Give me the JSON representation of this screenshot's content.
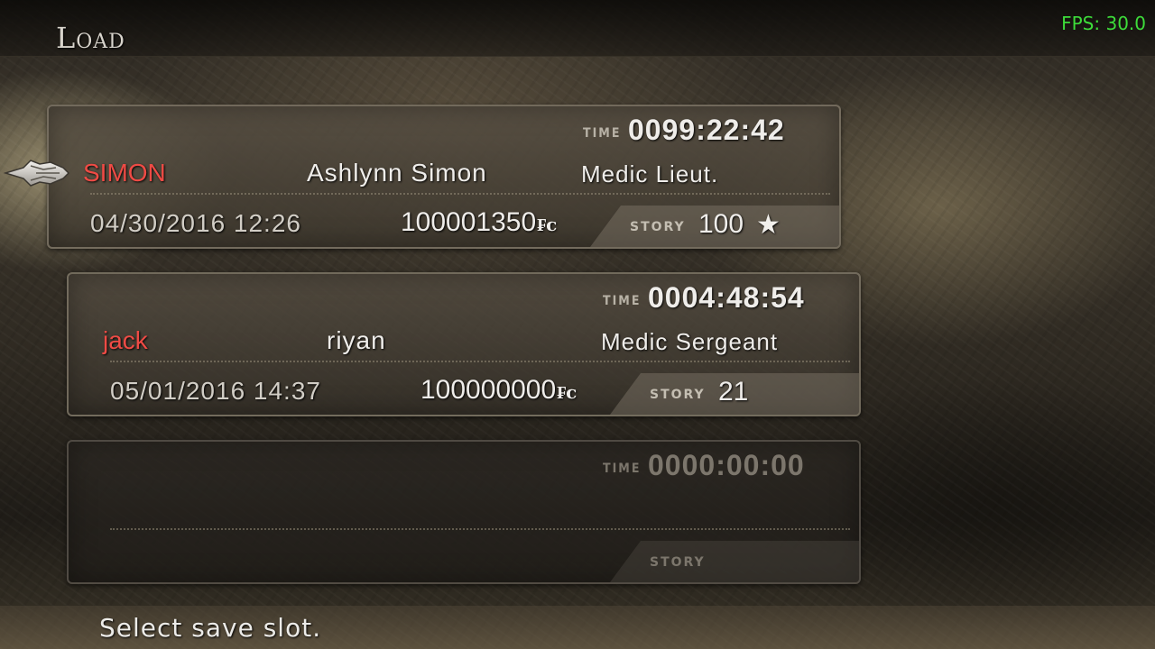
{
  "screen": {
    "title": "Load",
    "fps": "FPS: 30.0",
    "hint": "Select save slot."
  },
  "slots": [
    {
      "selected": true,
      "time_label": "TIME",
      "time": "0099:22:42",
      "player_name": "SIMON",
      "partner_name": "Ashlynn Simon",
      "rank": "Medic Lieut.",
      "date": "04/30/2016 12:26",
      "money": "100001350",
      "currency": "₣c",
      "story_label": "STORY",
      "story": "100",
      "star": "★"
    },
    {
      "selected": false,
      "time_label": "TIME",
      "time": "0004:48:54",
      "player_name": "jack",
      "partner_name": "riyan",
      "rank": "Medic Sergeant",
      "date": "05/01/2016 14:37",
      "money": "100000000",
      "currency": "₣c",
      "story_label": "STORY",
      "story": "21"
    },
    {
      "selected": false,
      "empty": true,
      "time_label": "TIME",
      "time": "0000:00:00",
      "story_label": "STORY"
    }
  ],
  "icons": {
    "cursor": "pointer-hand-icon",
    "star": "star-icon"
  },
  "colors": {
    "player_name": "#ef4b45",
    "fps": "#3ddc3a",
    "text": "#efedea"
  }
}
